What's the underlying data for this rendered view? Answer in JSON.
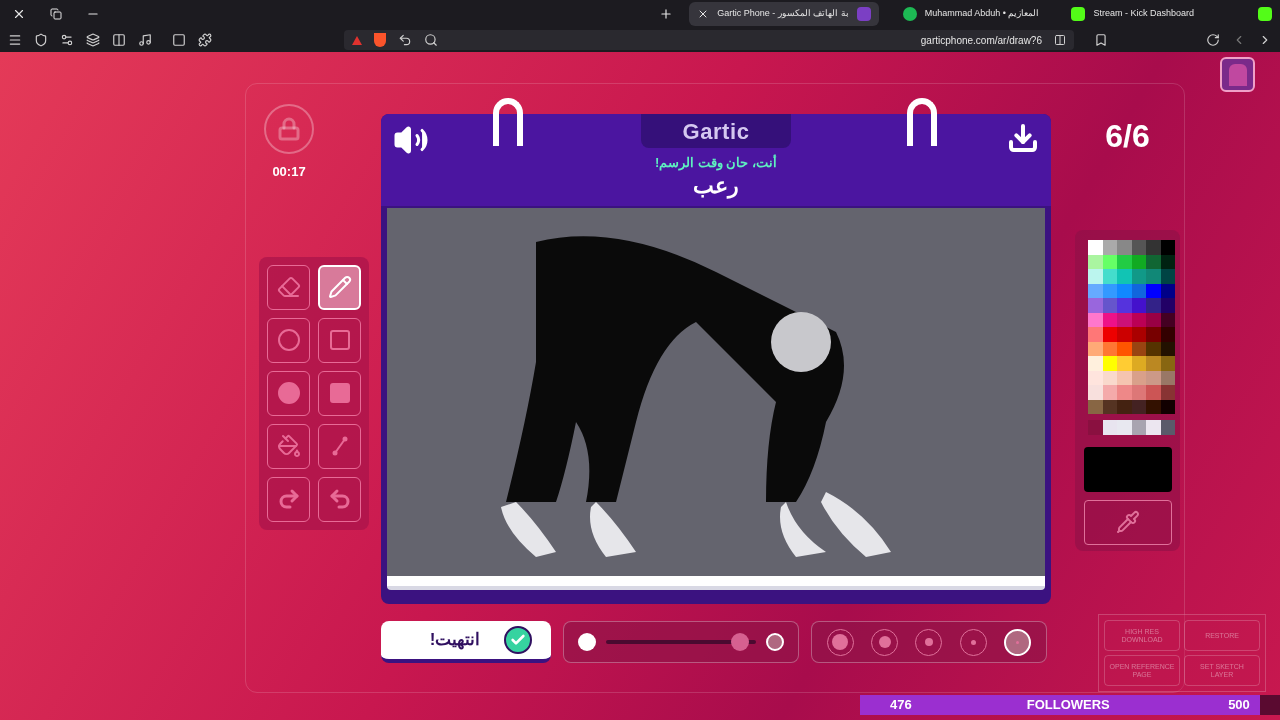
{
  "browser": {
    "tabs": [
      {
        "label": "Gartic Phone - بة الهاتف المكسور",
        "selected": true,
        "kind": "gartic"
      },
      {
        "label": "Muhammad Abduh • المعازيم",
        "selected": false,
        "kind": "music"
      },
      {
        "label": "Stream - Kick Dashboard",
        "selected": false,
        "kind": "kick"
      }
    ],
    "address": "garticphone.com/ar/draw?6"
  },
  "timer": {
    "time": "00:17"
  },
  "book": {
    "logo": "Gartic",
    "prompt": "أنت، حان وقت الرسم!",
    "word": "رعب"
  },
  "tools": [
    {
      "kind": "eraser",
      "selected": false
    },
    {
      "kind": "pencil",
      "selected": true
    },
    {
      "kind": "ellipse",
      "selected": false
    },
    {
      "kind": "rectangle",
      "selected": false
    },
    {
      "kind": "filled-ellipse",
      "selected": false
    },
    {
      "kind": "filled-rectangle",
      "selected": false
    },
    {
      "kind": "fill",
      "selected": false
    },
    {
      "kind": "line",
      "selected": false
    },
    {
      "kind": "redo",
      "selected": false
    },
    {
      "kind": "undo",
      "selected": false
    }
  ],
  "done_button": {
    "label": "انتهيت!"
  },
  "opacity": {
    "level": 0.95
  },
  "brush_sizes": [
    {
      "selected": false
    },
    {
      "selected": false
    },
    {
      "selected": false
    },
    {
      "selected": false
    },
    {
      "selected": true
    }
  ],
  "counter": "6/6",
  "palette": [
    [
      {
        "color": "#ffffff"
      },
      {
        "color": "#aaaaaa"
      },
      {
        "color": "#888888"
      },
      {
        "color": "#555555"
      },
      {
        "color": "#333333"
      },
      {
        "color": "#000000"
      }
    ],
    [
      {
        "color": "#aaf5a0"
      },
      {
        "color": "#66ff66"
      },
      {
        "color": "#22cc44"
      },
      {
        "color": "#11aa22"
      },
      {
        "color": "#116633"
      },
      {
        "color": "#002211"
      }
    ],
    [
      {
        "color": "#bbf5ee"
      },
      {
        "color": "#44ddcc"
      },
      {
        "color": "#11c4b4"
      },
      {
        "color": "#119988"
      },
      {
        "color": "#118877"
      },
      {
        "color": "#004444"
      }
    ],
    [
      {
        "color": "#66aaff"
      },
      {
        "color": "#3399ff"
      },
      {
        "color": "#1188ff"
      },
      {
        "color": "#1166dd"
      },
      {
        "color": "#0000ff"
      },
      {
        "color": "#000088"
      }
    ],
    [
      {
        "color": "#9966dd"
      },
      {
        "color": "#6655cc"
      },
      {
        "color": "#5533dd"
      },
      {
        "color": "#4411cc"
      },
      {
        "color": "#332288"
      },
      {
        "color": "#220066"
      }
    ],
    [
      {
        "color": "#ff77cc"
      },
      {
        "color": "#ee1188"
      },
      {
        "color": "#cc1177"
      },
      {
        "color": "#bb0055"
      },
      {
        "color": "#990044"
      },
      {
        "color": "#440022"
      }
    ],
    [
      {
        "color": "#ff7777"
      },
      {
        "color": "#ee0000"
      },
      {
        "color": "#cc0000"
      },
      {
        "color": "#aa0000"
      },
      {
        "color": "#770000"
      },
      {
        "color": "#330000"
      }
    ],
    [
      {
        "color": "#ffaa77"
      },
      {
        "color": "#ff7733"
      },
      {
        "color": "#ff5500"
      },
      {
        "color": "#994411"
      },
      {
        "color": "#553300"
      },
      {
        "color": "#221100"
      }
    ],
    [
      {
        "color": "#fff0dd"
      },
      {
        "color": "#ffff00"
      },
      {
        "color": "#ffcc33"
      },
      {
        "color": "#ddaa22"
      },
      {
        "color": "#bb8822"
      },
      {
        "color": "#886611"
      }
    ],
    [
      {
        "color": "#ffe4dd"
      },
      {
        "color": "#f9d9cc"
      },
      {
        "color": "#f5c4b0"
      },
      {
        "color": "#d9a08a"
      },
      {
        "color": "#cc9988"
      },
      {
        "color": "#997766"
      }
    ],
    [
      {
        "color": "#f8e0dd"
      },
      {
        "color": "#f4aaaa"
      },
      {
        "color": "#ee8888"
      },
      {
        "color": "#dd7777"
      },
      {
        "color": "#cc5555"
      },
      {
        "color": "#883333"
      }
    ],
    [
      {
        "color": "#886644"
      },
      {
        "color": "#553322"
      },
      {
        "color": "#442211"
      },
      {
        "color": "#442222"
      },
      {
        "color": "#331100"
      },
      {
        "color": "#110000"
      }
    ]
  ],
  "recent_colors": [
    {
      "color": "#8a1040"
    },
    {
      "color": "#e8e4ef"
    },
    {
      "color": "#e8e8f0"
    },
    {
      "color": "#a8a4b0"
    },
    {
      "color": "#ece6f0"
    },
    {
      "color": "#5a5a6a"
    }
  ],
  "current_color": {
    "color": "#000000"
  },
  "overlay_buttons": [
    {
      "label": "HIGH RES DOWNLOAD"
    },
    {
      "label": "RESTORE"
    },
    {
      "label": "OPEN REFERENCE PAGE"
    },
    {
      "label": "SET SKETCH LAYER"
    }
  ],
  "followers_goal": {
    "current": "476",
    "label": "FOLLOWERS",
    "target": "500",
    "level": 0.952
  }
}
